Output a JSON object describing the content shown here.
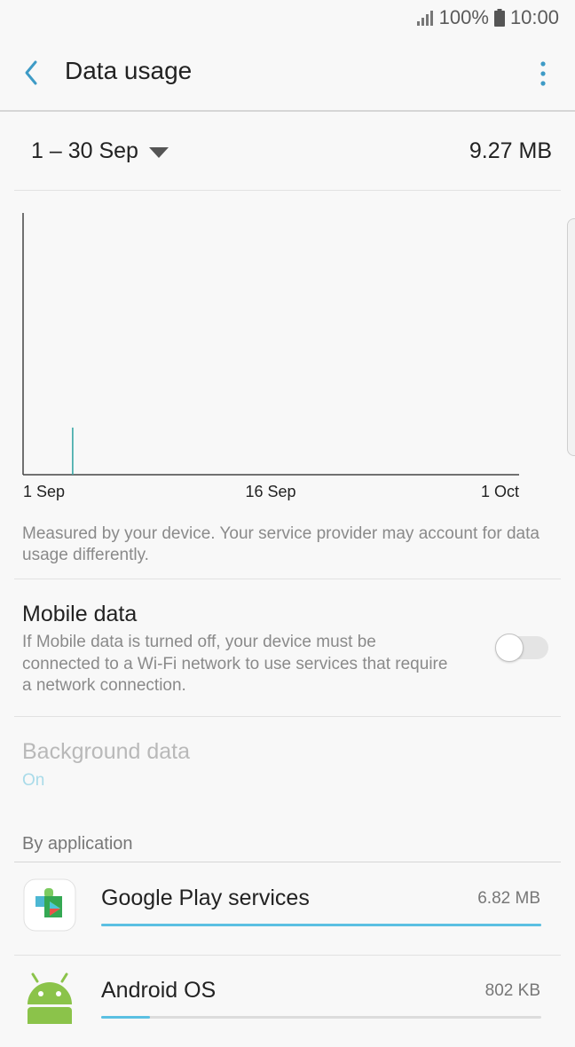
{
  "status_bar": {
    "battery_percent": "100%",
    "time": "10:00"
  },
  "app_bar": {
    "title": "Data usage"
  },
  "period": {
    "label": "1 – 30 Sep",
    "total": "9.27 MB"
  },
  "chart_data": {
    "type": "line",
    "x_ticks": [
      "1 Sep",
      "16 Sep",
      "1 Oct"
    ],
    "x_domain_days": [
      1,
      31
    ],
    "points": [
      {
        "day": 4,
        "value": 0.18
      }
    ],
    "spike_color": "#3aa7a5",
    "grid": false
  },
  "measurement_note": "Measured by your device. Your service provider may account for data usage differently.",
  "mobile_data": {
    "title": "Mobile data",
    "description": "If Mobile data is turned off, your device must be connected to a Wi-Fi network to use services that require a network connection.",
    "enabled": false
  },
  "background_data": {
    "title": "Background data",
    "status": "On"
  },
  "apps_section": {
    "header": "By application",
    "apps": [
      {
        "name": "Google Play services",
        "size": "6.82 MB",
        "fraction": 1.0,
        "icon": "google-play-services-icon"
      },
      {
        "name": "Android OS",
        "size": "802 KB",
        "fraction": 0.11,
        "icon": "android-icon"
      }
    ]
  },
  "colors": {
    "accent": "#5bc0e2",
    "toolbar_icon": "#3e9bc6"
  }
}
